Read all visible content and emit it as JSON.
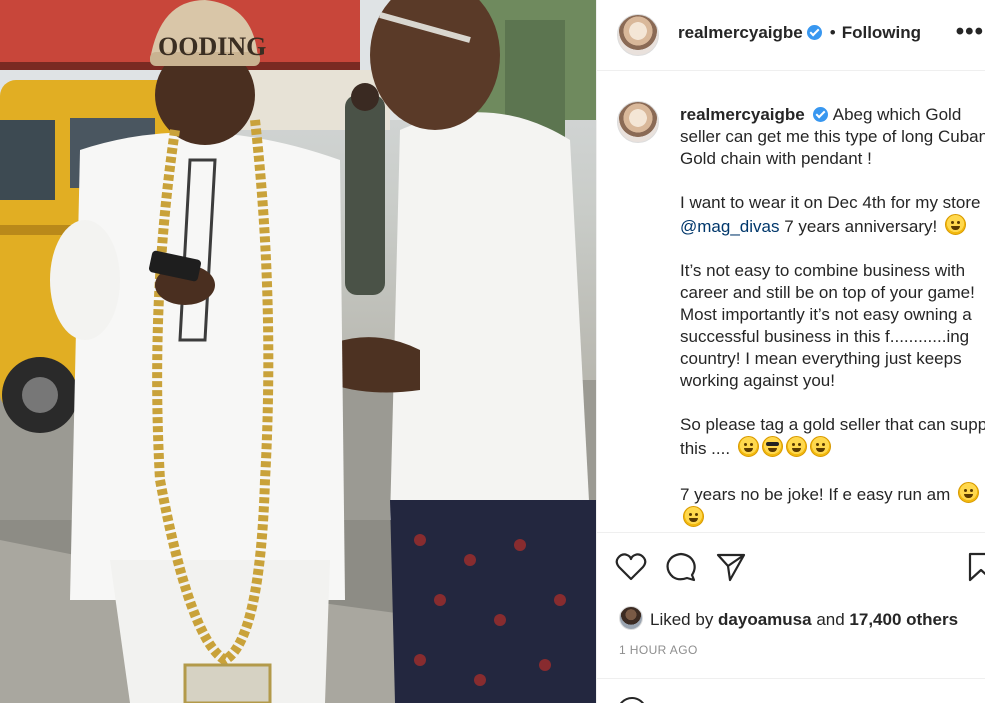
{
  "post": {
    "username": "realmercyaigbe",
    "separator": "•",
    "follow_status": "Following",
    "more_label": "•••",
    "cap_text": "OODING"
  },
  "caption": {
    "username": "realmercyaigbe",
    "line1": "Abeg which Gold seller can get me this type of long Cuban Gold chain with pendant !",
    "line2_pre": "I want to wear it on Dec 4th for my store ",
    "mention": "@mag_divas",
    "line2_post": " 7 years anniversary! ",
    "line3": "It’s not easy to combine business with career and still be on top of your game! Most importantly it’s not easy owning a successful business in this f............ing country! I mean everything just keeps working against you!",
    "line4": "So please tag a gold seller that can supply this .... ",
    "line5": "7 years no be joke! If e easy run am "
  },
  "actions": {
    "like_icon": "heart-icon",
    "comment_icon": "comment-icon",
    "share_icon": "paper-plane-icon",
    "save_icon": "bookmark-icon"
  },
  "likes": {
    "prefix": "Liked by ",
    "user": "dayoamusa",
    "middle": " and ",
    "count": "17,400 others"
  },
  "timestamp": "1 HOUR AGO",
  "colors": {
    "verified": "#3897f0",
    "mention": "#00376b",
    "muted": "#8e8e8e",
    "border": "#efefef"
  }
}
